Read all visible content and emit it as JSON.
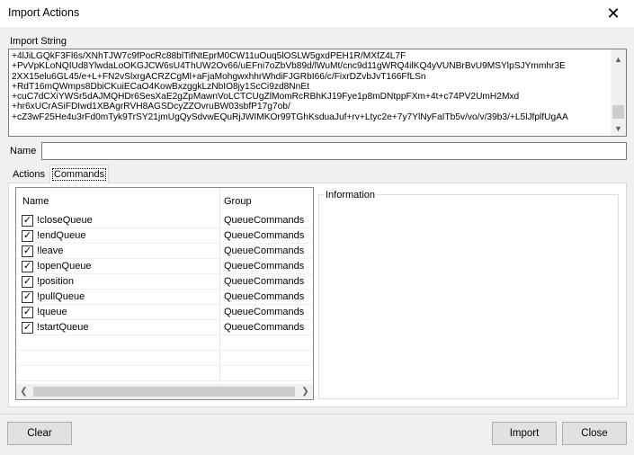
{
  "window": {
    "title": "Import Actions",
    "close_glyph": "✕"
  },
  "import_string": {
    "label": "Import String",
    "lines": [
      "+4lJiLGQkF3Fl6s/XNhTJW7c9fPocRc88blTifNtEprM0CW11uOuq5lOSLW5gxdPEH1R/MXfZ4L7F",
      "+PvVpKLoNQIUd8YlwdaLoOKGJCW6sU4ThUW2Ov66/uEFni7oZbVb89d/lWuMt/cnc9d11gWRQ4ilKQ4yVUNBrBvU9MSYlpSJYmmhr3E",
      "2XX15elu6GL45/e+L+FN2vSlxrgACRZCgMl+aFjaMohgwxhhrWhdiFJGRbI66/c/FixrDZvbJvT166FfLSn",
      "+RdT16mQWmps8DbiCKuiECaO4KowBxzggkLzNbIO8jy1ScCi9zd8NnEt",
      "+cuC7dCXiYWSr5dAJMQHDr6SesXaE2gZpMawnVoLCTCUgZlMomRcRBhKJ19Fye1p8mDNtppFXm+4t+c74PV2UmH2Mxd",
      "+hr6xUCrASiFDIwd1XBAgrRVH8AGSDcyZZOvruBW03sbfP17g7ob/",
      "+cZ3wF25He4u3rFd0mTyk9TrSY21jmUgQySdvwEQuRjJWIMKOr99TGhKsduaJuf+rv+Ltyc2e+7y7YlNyFaITb5v/vo/v/39b3/+L5lJfplfUgAA"
    ]
  },
  "name_field": {
    "label": "Name",
    "value": ""
  },
  "tabs": [
    {
      "label": "Actions"
    },
    {
      "label": "Commands"
    }
  ],
  "commands_list": {
    "headers": {
      "name": "Name",
      "group": "Group"
    },
    "rows": [
      {
        "name": "!closeQueue",
        "group": "QueueCommands",
        "checked": true
      },
      {
        "name": "!endQueue",
        "group": "QueueCommands",
        "checked": true
      },
      {
        "name": "!leave",
        "group": "QueueCommands",
        "checked": true
      },
      {
        "name": "!openQueue",
        "group": "QueueCommands",
        "checked": true
      },
      {
        "name": "!position",
        "group": "QueueCommands",
        "checked": true
      },
      {
        "name": "!pullQueue",
        "group": "QueueCommands",
        "checked": true
      },
      {
        "name": "!queue",
        "group": "QueueCommands",
        "checked": true
      },
      {
        "name": "!startQueue",
        "group": "QueueCommands",
        "checked": true
      }
    ],
    "check_glyph": "✓"
  },
  "information": {
    "label": "Information"
  },
  "buttons": {
    "clear": "Clear",
    "import": "Import",
    "close": "Close"
  },
  "scroll_glyphs": {
    "up": "▲",
    "down": "▼",
    "left": "❮",
    "right": "❯"
  }
}
